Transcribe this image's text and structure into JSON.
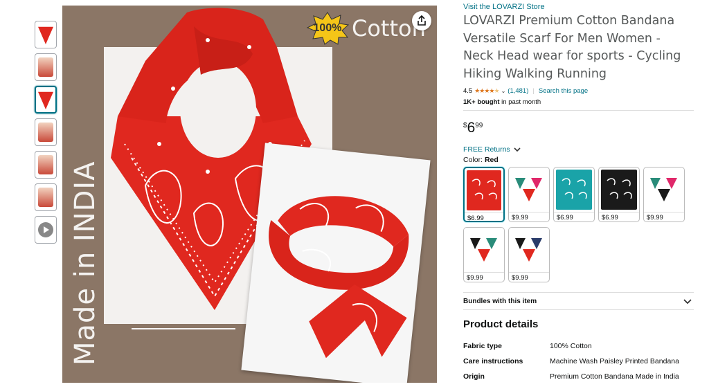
{
  "thumbnails": [
    {
      "kind": "red",
      "active": false
    },
    {
      "kind": "people",
      "active": false
    },
    {
      "kind": "red",
      "active": true
    },
    {
      "kind": "people",
      "active": false
    },
    {
      "kind": "people",
      "active": false
    },
    {
      "kind": "people",
      "active": false
    },
    {
      "kind": "video",
      "active": false
    }
  ],
  "main_image": {
    "side_text": "Made in INDIA",
    "badge_text": "100%",
    "cotton_label": "Cotton",
    "icon": "share-icon",
    "colors": {
      "bandana_red": "#e0281f",
      "background": "#8b7666",
      "panel": "#f3f1ef"
    }
  },
  "product": {
    "store_link": "Visit the LOVARZI Store",
    "title": "LOVARZI Premium Cotton Bandana Versatile Scarf For Men Women - Neck Head wear for sports - Cycling Hiking Walking Running",
    "rating": "4.5",
    "rating_count": "(1,481)",
    "search_link": "Search this page",
    "bought_bold": "1K+ bought",
    "bought_rest": " in past month",
    "price_symbol": "$",
    "price_whole": "6",
    "price_fraction": "99",
    "returns": "FREE Returns",
    "color_label": "Color:",
    "color_value": "Red"
  },
  "swatches": [
    {
      "price": "$6.99",
      "bg": "#e0281f",
      "selected": true
    },
    {
      "price": "$9.99",
      "bg": "#ffffff",
      "selected": false
    },
    {
      "price": "$6.99",
      "bg": "#1aa3a8",
      "selected": false
    },
    {
      "price": "$6.99",
      "bg": "#1a1a1a",
      "selected": false
    },
    {
      "price": "$9.99",
      "bg": "#ffffff",
      "selected": false
    },
    {
      "price": "$9.99",
      "bg": "#ffffff",
      "selected": false
    },
    {
      "price": "$9.99",
      "bg": "#ffffff",
      "selected": false
    }
  ],
  "bundles_label": "Bundles with this item",
  "product_details": {
    "heading": "Product details",
    "rows": [
      {
        "key": "Fabric type",
        "value": "100% Cotton"
      },
      {
        "key": "Care instructions",
        "value": "Machine Wash Paisley Printed Bandana"
      },
      {
        "key": "Origin",
        "value": "Premium Cotton Bandana Made in India"
      }
    ]
  }
}
